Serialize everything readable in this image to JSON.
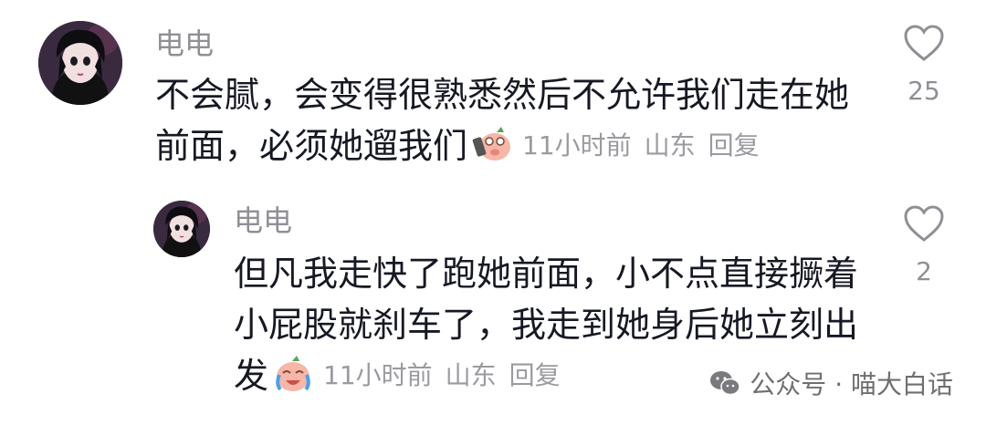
{
  "comments": [
    {
      "username": "电电",
      "lines": [
        "不会腻，会变得很熟悉然后不允许我们走在她",
        "前面，必须她遛我们"
      ],
      "emoji": "pig-phone-emoji",
      "time": "11小时前",
      "location": "山东",
      "reply": "回复",
      "likes": "25"
    },
    {
      "username": "电电",
      "lines": [
        "但凡我走快了跑她前面，小不点直接撅着",
        "小屁股就刹车了，我走到她身后她立刻出",
        "发"
      ],
      "emoji": "crying-laugh-emoji",
      "time": "11小时前",
      "location": "山东",
      "reply": "回复",
      "likes": "2"
    }
  ],
  "watermark": {
    "text": "公众号 · 喵大白话",
    "icon": "wechat-icon"
  },
  "colors": {
    "text": "#161823",
    "secondary": "#8f8f95",
    "background": "#ffffff"
  }
}
